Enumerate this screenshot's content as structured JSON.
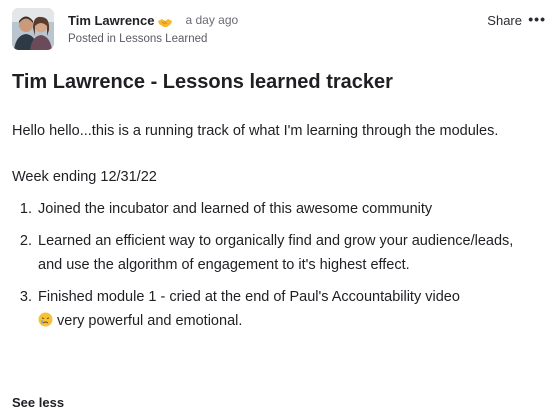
{
  "author": {
    "name": "Tim Lawrence",
    "badge_icon": "handshake-emoji-icon",
    "timestamp": "a day ago",
    "posted_in_prefix": "Posted in",
    "category": "Lessons Learned"
  },
  "actions": {
    "share_label": "Share",
    "more_label": "•••"
  },
  "post": {
    "title": "Tim Lawrence - Lessons learned tracker",
    "intro": "Hello hello...this is a running track of what I'm learning through the modules.",
    "week_label": "Week ending 12/31/22",
    "items": [
      {
        "text": "Joined the incubator and learned of this awesome community"
      },
      {
        "text": "Learned an efficient way to organically find and grow your audience/leads, and use the algorithm of engagement to it's highest effect."
      },
      {
        "text": "Finished module 1 - cried at the end of Paul's Accountability video",
        "emoji": "sad-face-emoji-icon",
        "text_after": "very powerful and emotional."
      }
    ],
    "see_less_label": "See less"
  },
  "colors": {
    "text": "#1f1f24",
    "muted": "#6b6b75",
    "badge": "#f5b82e"
  }
}
